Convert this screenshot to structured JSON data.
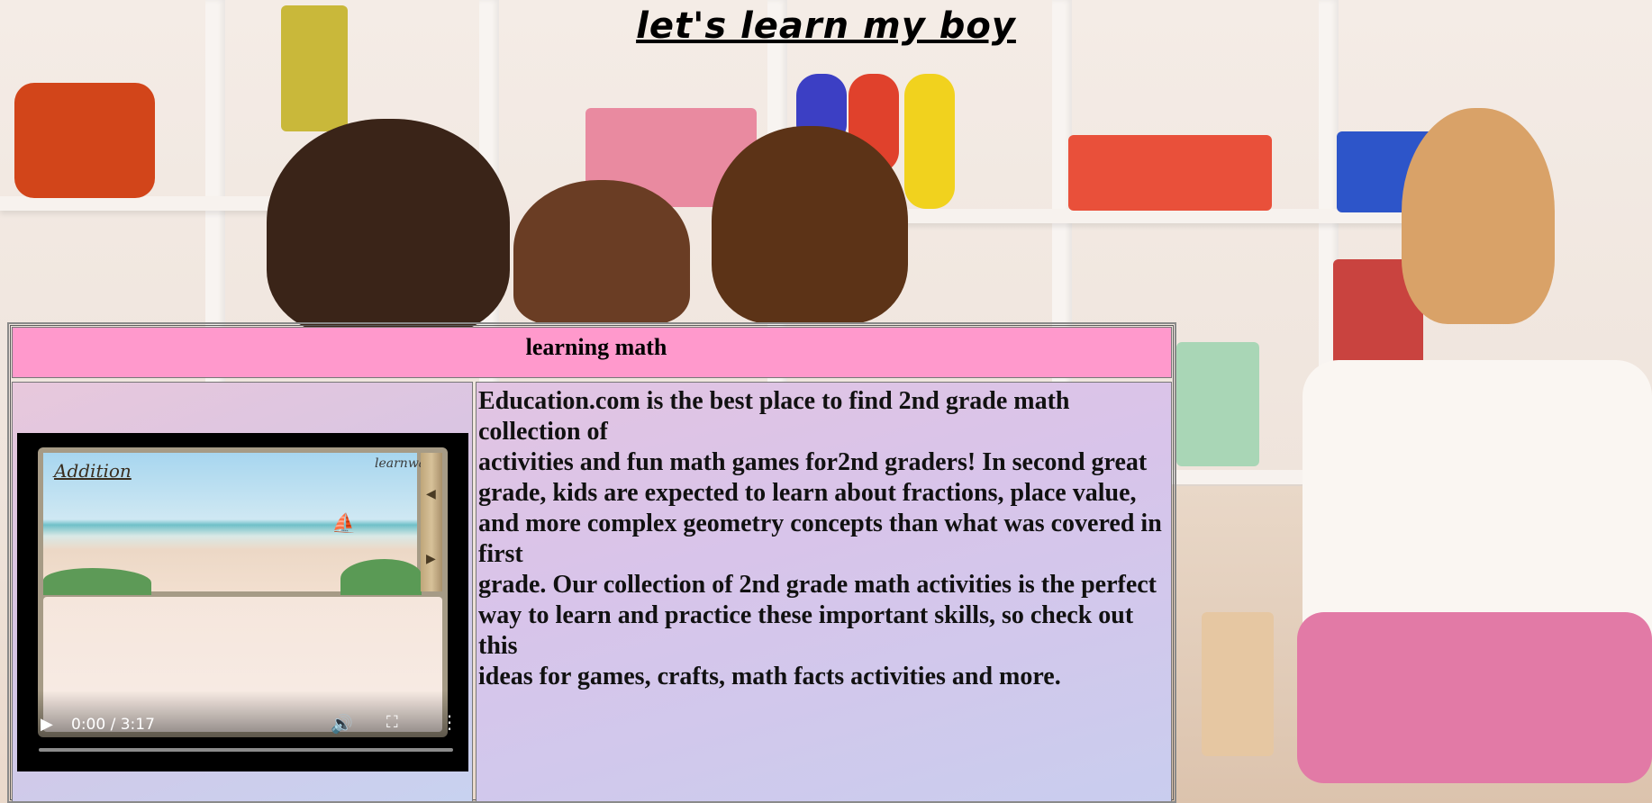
{
  "page": {
    "title": "let's learn my boy"
  },
  "table": {
    "header": "learning math",
    "paragraph_lines": [
      "Education.com is the best place to find 2nd grade math collection of",
      "activities and fun math games for2nd graders! In second great",
      "grade, kids are expected to learn about fractions, place value,",
      "and more complex geometry concepts than what was covered in first",
      "grade. Our collection of 2nd grade math activities is the perfect",
      "way to learn and practice these important skills, so check out this",
      "ideas for games, crafts, math facts activities and more."
    ]
  },
  "video": {
    "current_time": "0:00",
    "duration": "3:17",
    "time_display": "0:00 / 3:17",
    "progress": 0,
    "frame_label": "Addition",
    "frame_brand": "learnware",
    "icons": {
      "play": "play-icon",
      "volume": "volume-icon",
      "fullscreen": "fullscreen-icon",
      "menu": "more-options-icon"
    }
  },
  "colors": {
    "header_bg": "#ff99cc",
    "cell_gradient": "#d8c4ea"
  }
}
